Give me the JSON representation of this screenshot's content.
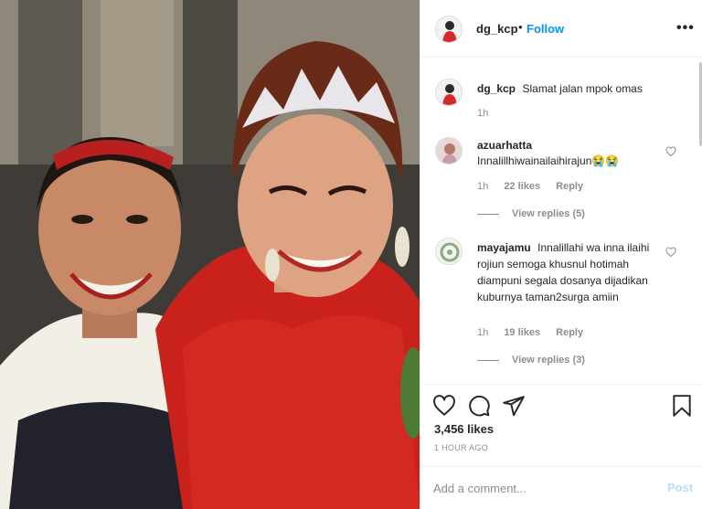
{
  "post": {
    "username": "dg_kcp",
    "separator": "•",
    "follow_label": "Follow",
    "more_icon": "more-options-icon",
    "more_label": "•••"
  },
  "caption": {
    "username": "dg_kcp",
    "text": "Slamat jalan mpok omas",
    "time": "1h"
  },
  "comments": [
    {
      "username": "azuarhatta",
      "text": "Innalillhiwainailaihirajun😭😭",
      "time": "1h",
      "likes": "22 likes",
      "reply_label": "Reply",
      "view_replies": "View replies (5)"
    },
    {
      "username": "mayajamu",
      "text": "Innalillahi wa inna ilaihi rojiun semoga khusnul hotimah diampuni segala dosanya dijadikan kuburnya taman2surga amiin",
      "time": "1h",
      "likes": "19 likes",
      "reply_label": "Reply",
      "view_replies": "View replies (3)"
    }
  ],
  "stats": {
    "likes": "3,456 likes",
    "posted": "1 HOUR AGO"
  },
  "add_comment": {
    "placeholder": "Add a comment...",
    "post_label": "Post"
  },
  "colors": {
    "follow_blue": "#0095f6",
    "post_disabled": "#b2dffc",
    "meta_gray": "#8e8e8e",
    "text": "#262626"
  }
}
